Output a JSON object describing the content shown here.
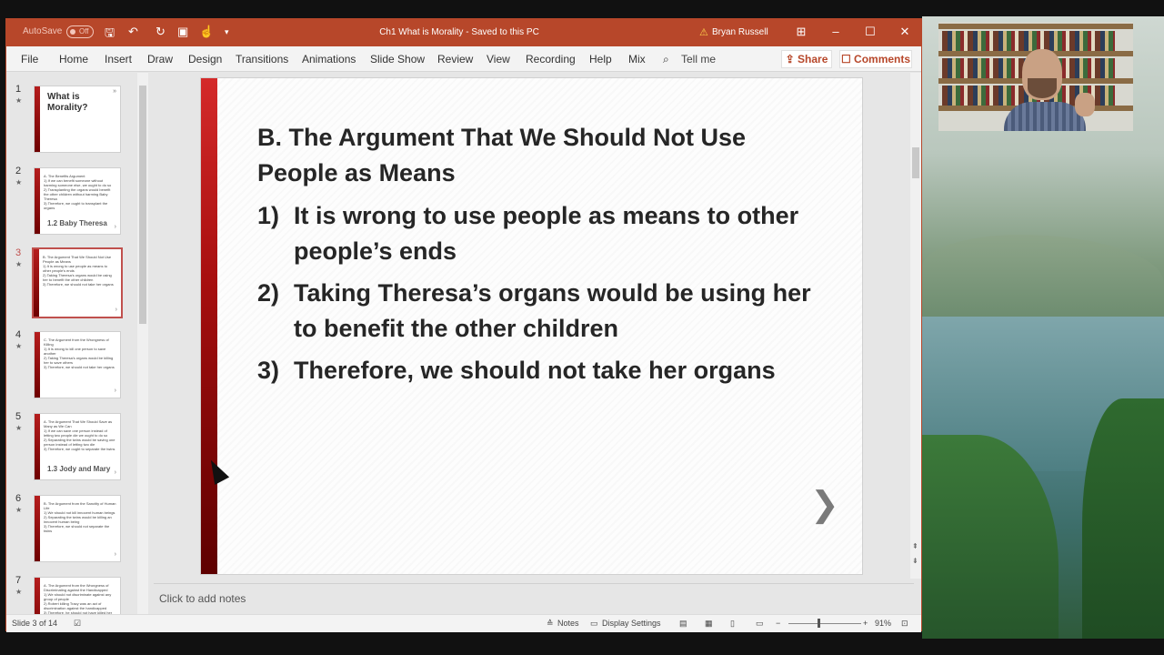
{
  "titlebar": {
    "autosave_label": "AutoSave",
    "autosave_state": "Off",
    "document_title": "Ch1 What is Morality  -  Saved to this PC",
    "user_name": "Bryan Russell",
    "accent_color": "#b7472a"
  },
  "ribbon": {
    "tabs": [
      "File",
      "Home",
      "Insert",
      "Draw",
      "Design",
      "Transitions",
      "Animations",
      "Slide Show",
      "Review",
      "View",
      "Recording",
      "Help",
      "Mix"
    ],
    "tell_me": "Tell me",
    "share": "Share",
    "comments": "Comments"
  },
  "thumbnails": [
    {
      "number": "1",
      "title": "What is Morality?",
      "lines": [],
      "subtitle": ""
    },
    {
      "number": "2",
      "title": "",
      "lines": [
        "A. The Benefits Argument",
        "1) If we can benefit someone without harming someone else, we ought to do so",
        "2) Transplanting the organs would benefit the other children without harming Baby Theresa",
        "3) Therefore, we ought to transplant the organs"
      ],
      "subtitle": "1.2 Baby Theresa"
    },
    {
      "number": "3",
      "title": "",
      "lines": [
        "B. The Argument That We Should Not Use People as Means",
        "1) It is wrong to use people as means to other people's ends",
        "2) Taking Theresa's organs would be using her to benefit the other children",
        "3) Therefore, we should not take her organs"
      ],
      "subtitle": ""
    },
    {
      "number": "4",
      "title": "",
      "lines": [
        "C. The Argument from the Wrongness of Killing",
        "1) It is wrong to kill one person to save another",
        "2) Taking Theresa's organs would be killing her to save others",
        "3) Therefore, we should not take her organs"
      ],
      "subtitle": ""
    },
    {
      "number": "5",
      "title": "",
      "lines": [
        "A. The Argument That We Should Save as Many as We Can",
        "1) If we can save one person instead of letting two people die we ought to do so",
        "2) Separating the twins would be saving one person instead of letting two die",
        "3) Therefore, we ought to separate the twins"
      ],
      "subtitle": "1.3 Jody and Mary"
    },
    {
      "number": "6",
      "title": "",
      "lines": [
        "B. The Argument from the Sanctity of Human Life",
        "1) We should not kill innocent human beings",
        "2) Separating the twins would be killing an innocent human being",
        "3) Therefore, we should not separate the twins"
      ],
      "subtitle": ""
    },
    {
      "number": "7",
      "title": "",
      "lines": [
        "A. The Argument from the Wrongness of Discriminating against the Handicapped",
        "1) We should not discriminate against any group of people",
        "2) Robert killing Tracy was an act of discrimination against the handicapped",
        "3) Therefore, he should not have killed her"
      ],
      "subtitle": ""
    }
  ],
  "slide": {
    "heading": "B. The Argument That We Should Not Use People as Means",
    "items": [
      {
        "num": "1)",
        "text": "It is wrong to use people as means to other people’s ends"
      },
      {
        "num": "2)",
        "text": "Taking Theresa’s organs would be using her to benefit the other children"
      },
      {
        "num": "3)",
        "text": "Therefore, we should not take her organs"
      }
    ],
    "next_glyph": "❯"
  },
  "notes_placeholder": "Click to add notes",
  "statusbar": {
    "slide_counter": "Slide 3 of 14",
    "notes": "Notes",
    "display_settings": "Display Settings",
    "zoom": "91%"
  }
}
